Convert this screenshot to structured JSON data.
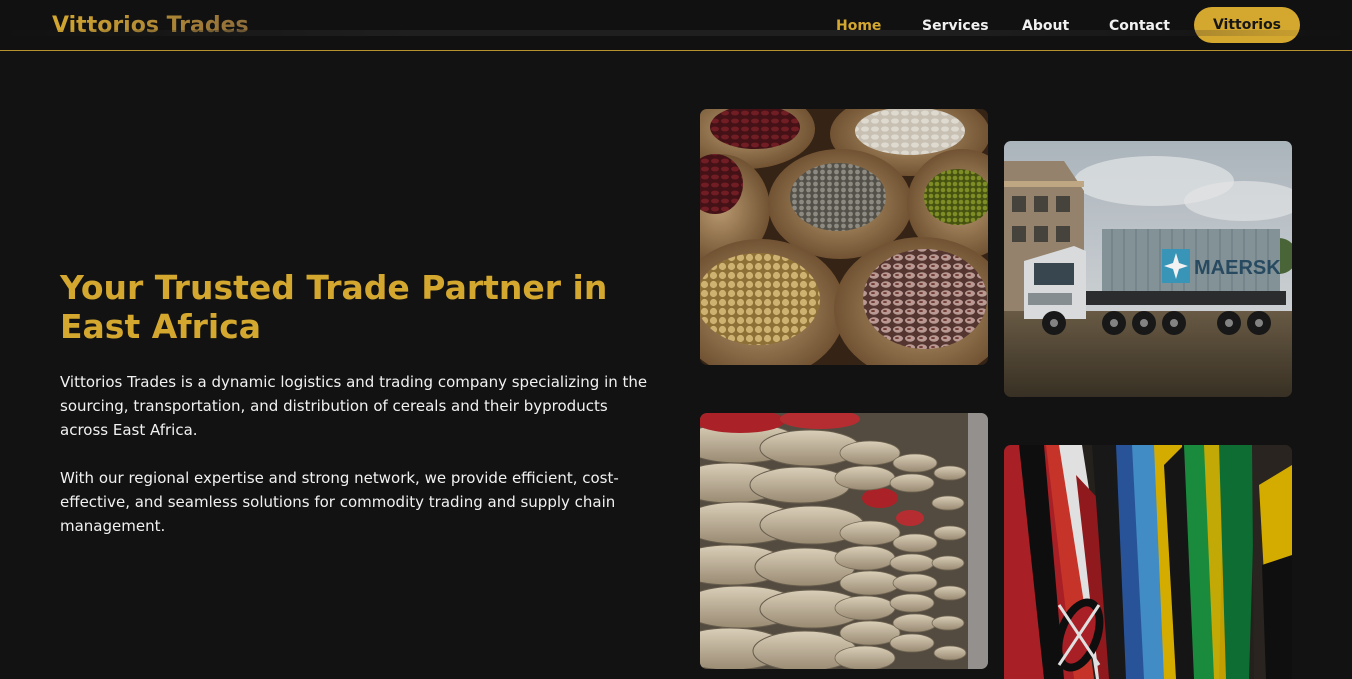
{
  "nav": {
    "brand": "Vittorios Trades",
    "links": [
      "Home",
      "Services",
      "About",
      "Contact"
    ],
    "active": "Home",
    "cta": "Vittorios"
  },
  "hero": {
    "title": "Your Trusted Trade Partner in East Africa",
    "p1": "Vittorios Trades is a dynamic logistics and trading company specializing in the sourcing, transportation, and distribution of cereals and their byproducts across East Africa.",
    "p2": "With our regional expertise and strong network, we provide efficient, cost-effective, and seamless solutions for commodity trading and supply chain management."
  },
  "images": {
    "truck_logo": "MAERSK"
  },
  "colors": {
    "background": "#121212",
    "accent": "#d4a72f",
    "text": "#f1f1f1",
    "nav_border": "#b8922d"
  }
}
